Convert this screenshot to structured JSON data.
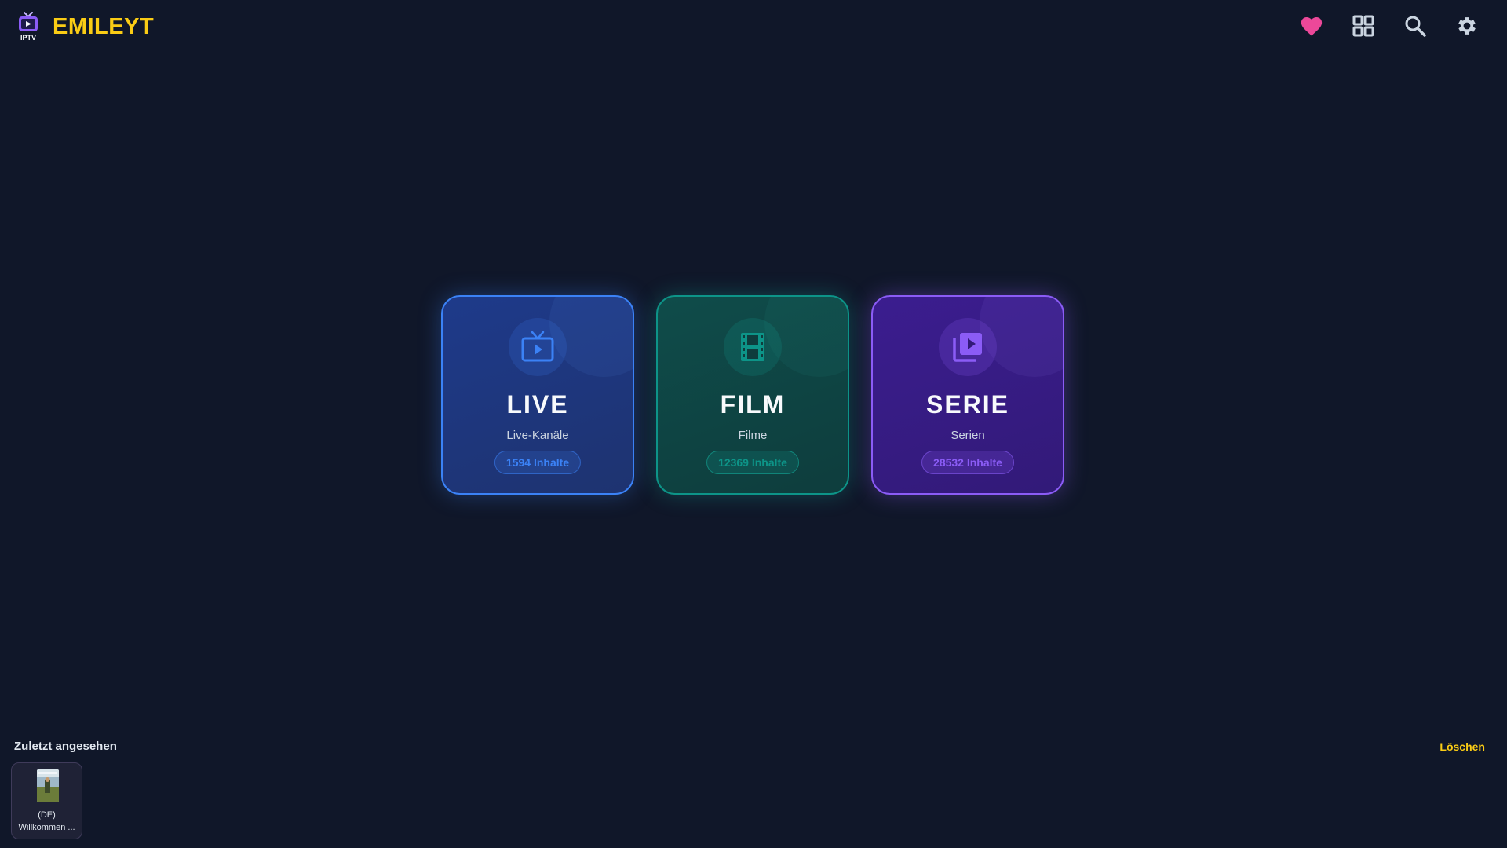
{
  "header": {
    "logo_text": "IPTV",
    "brand": "EMILEYT",
    "icons": [
      "heart-icon",
      "grid-icon",
      "search-icon",
      "gear-icon"
    ]
  },
  "categories": [
    {
      "title": "LIVE",
      "subtitle": "Live-Kanäle",
      "badge": "1594 Inhalte",
      "icon": "tv-icon",
      "color": "#3b82f6"
    },
    {
      "title": "FILM",
      "subtitle": "Filme",
      "badge": "12369 Inhalte",
      "icon": "film-icon",
      "color": "#0d9488"
    },
    {
      "title": "SERIE",
      "subtitle": "Serien",
      "badge": "28532 Inhalte",
      "icon": "video-library-icon",
      "color": "#8b5cf6"
    }
  ],
  "recent": {
    "title": "Zuletzt angesehen",
    "clear_label": "Löschen",
    "items": [
      {
        "line1": "(DE)",
        "line2": "Willkommen ..."
      }
    ]
  },
  "colors": {
    "background": "#101729",
    "accent": "#facc15",
    "heart": "#ec4899"
  }
}
